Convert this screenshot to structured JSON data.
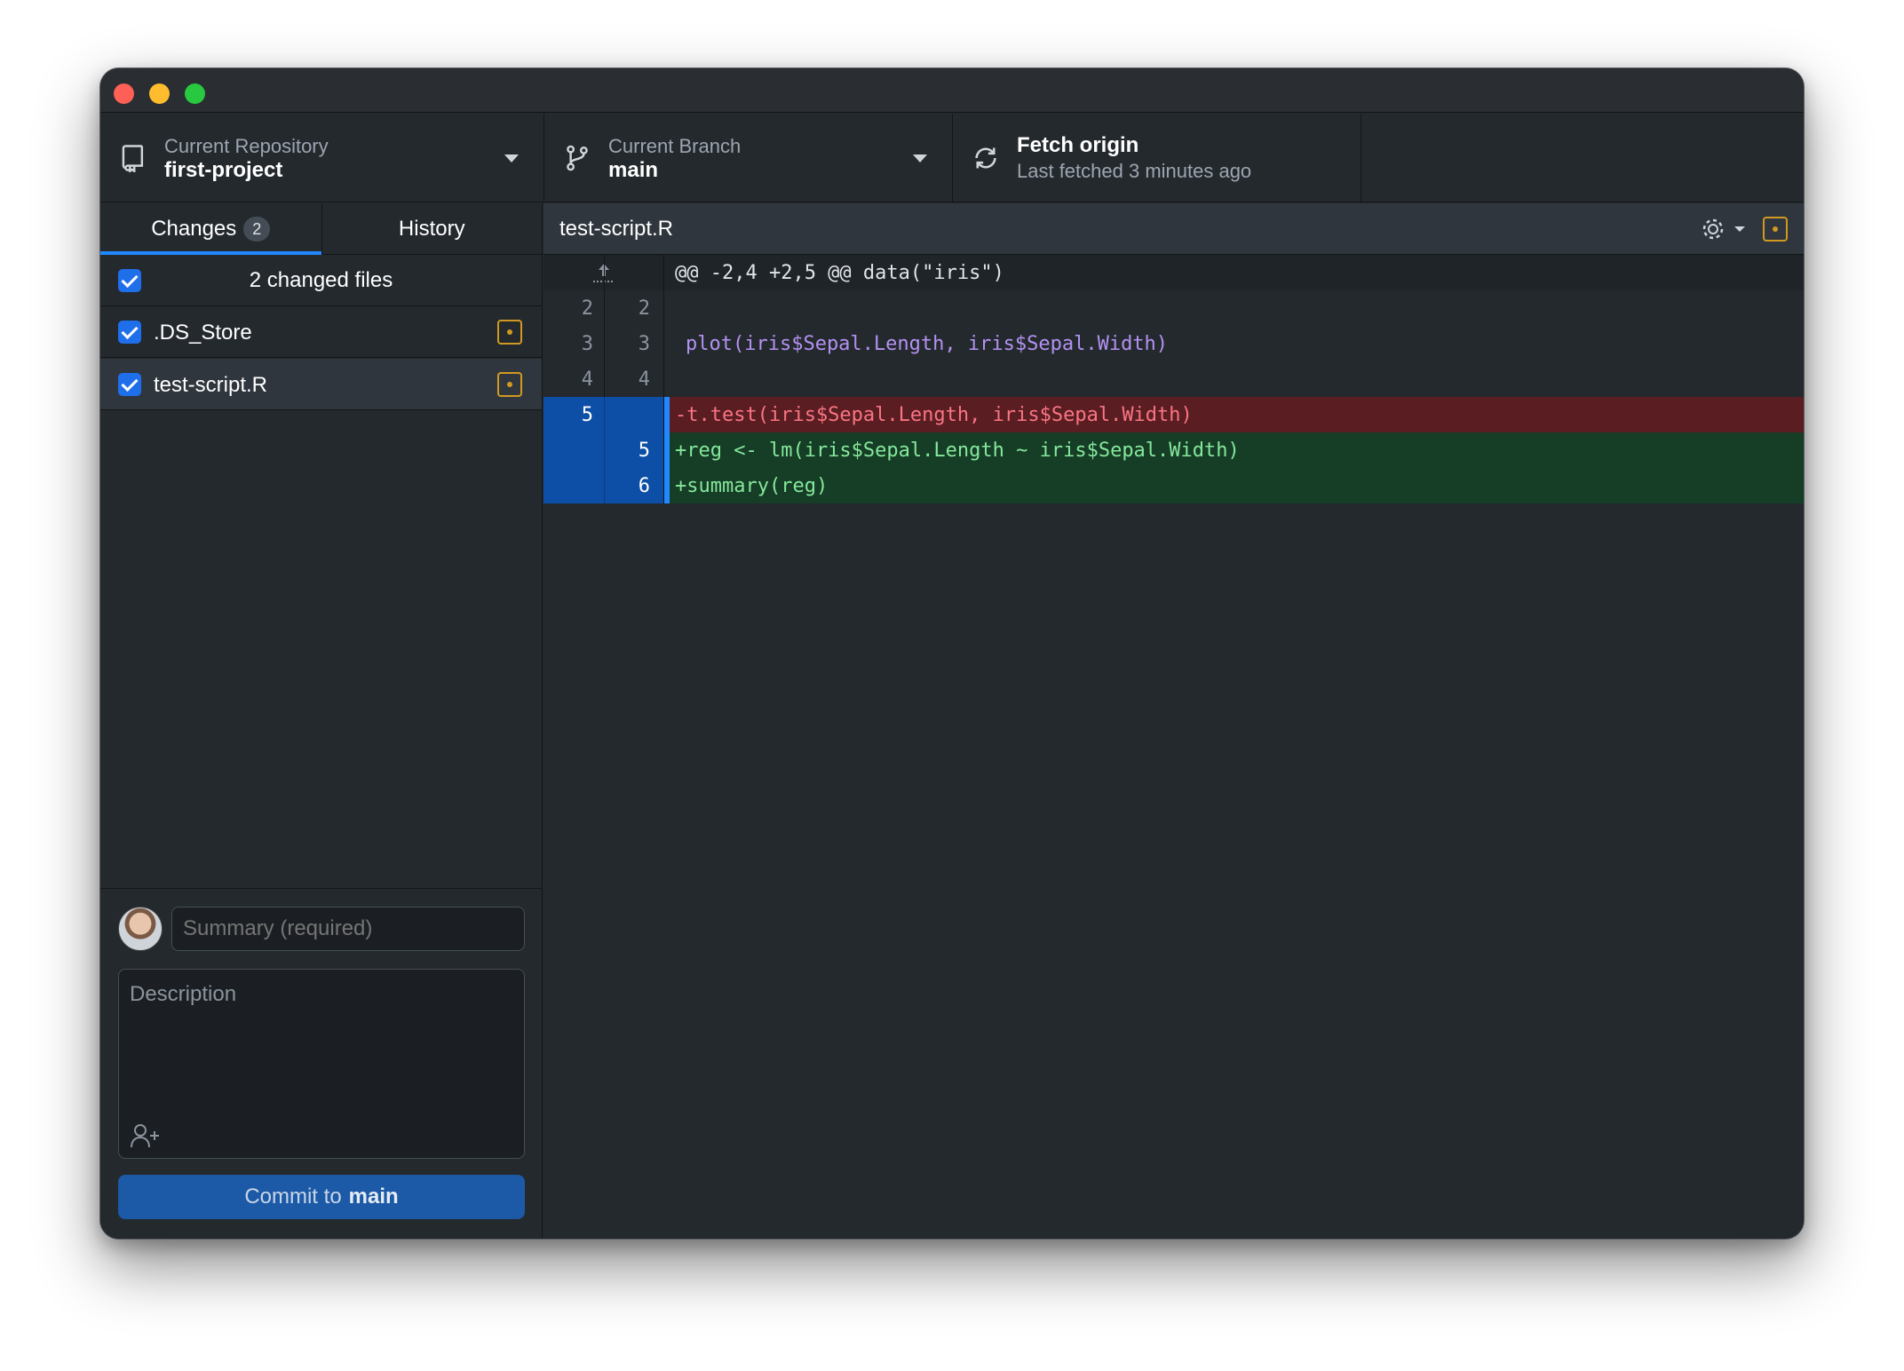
{
  "window": {
    "title_controls": [
      "close",
      "minimize",
      "maximize"
    ]
  },
  "toolbar": {
    "repository": {
      "label": "Current Repository",
      "value": "first-project",
      "icon": "repo-icon"
    },
    "branch": {
      "label": "Current Branch",
      "value": "main",
      "icon": "branch-icon"
    },
    "fetch": {
      "title": "Fetch origin",
      "subtitle": "Last fetched 3 minutes ago",
      "icon": "sync-icon"
    }
  },
  "sidebar": {
    "tabs": [
      {
        "label": "Changes",
        "badge": "2",
        "active": true
      },
      {
        "label": "History",
        "active": false
      }
    ],
    "changed_files_label": "2 changed files",
    "files": [
      {
        "name": ".DS_Store",
        "checked": true,
        "status": "modified",
        "selected": false
      },
      {
        "name": "test-script.R",
        "checked": true,
        "status": "modified",
        "selected": true
      }
    ]
  },
  "commit": {
    "summary_placeholder": "Summary (required)",
    "description_placeholder": "Description",
    "button_prefix": "Commit to",
    "button_branch": "main"
  },
  "diff": {
    "file_name": "test-script.R",
    "hunk_header": "@@ -2,4 +2,5 @@ data(\"iris\")",
    "lines": [
      {
        "type": "context",
        "old": "2",
        "new": "2",
        "text": ""
      },
      {
        "type": "context",
        "old": "3",
        "new": "3",
        "text": "plot(iris$Sepal.Length, iris$Sepal.Width)"
      },
      {
        "type": "context",
        "old": "4",
        "new": "4",
        "text": ""
      },
      {
        "type": "deletion",
        "old": "5",
        "new": "",
        "text": "-t.test(iris$Sepal.Length, iris$Sepal.Width)"
      },
      {
        "type": "addition",
        "old": "",
        "new": "5",
        "text": "+reg <- lm(iris$Sepal.Length ~ iris$Sepal.Width)"
      },
      {
        "type": "addition",
        "old": "",
        "new": "6",
        "text": "+summary(reg)"
      }
    ]
  },
  "colors": {
    "background": "#24292e",
    "accent": "#2188ff",
    "deletion_bg": "#5a1d22",
    "addition_bg": "#163d25",
    "modified": "#d29922",
    "commit_button": "#1c5aa7"
  }
}
